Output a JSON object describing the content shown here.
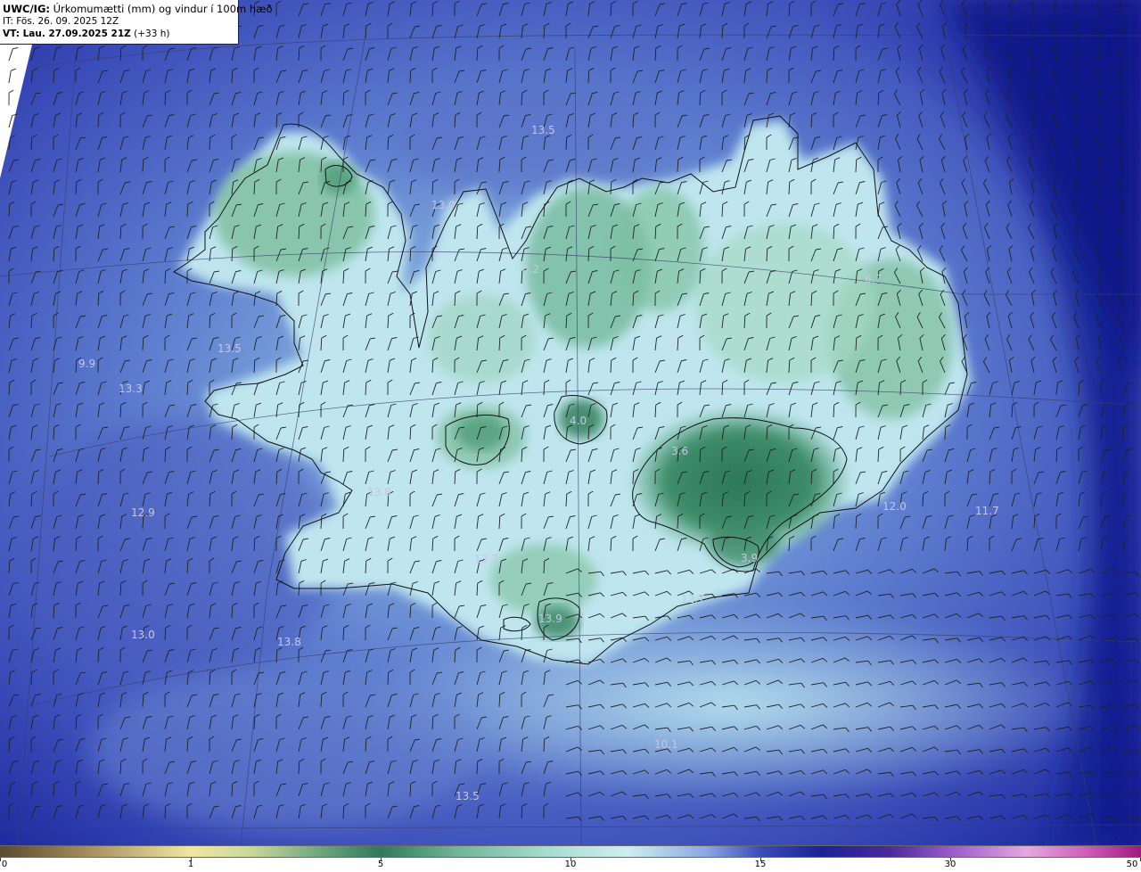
{
  "header": {
    "model": "UWC/IG:",
    "product": " Úrkomumætti (mm) og vindur í 100m hæð",
    "init_label": "IT: Fös. 26. 09. 2025 12Z",
    "valid_prefix": "VT: Lau. 27.09.2025 21Z",
    "valid_suffix": " (+33 h)"
  },
  "colors": {
    "ocean_deep": "#101a8c",
    "ocean_mid": "#3a4cb8",
    "ocean_light": "#6f86d4",
    "pale": "#bfe6ef",
    "cyan": "#8fd6dc",
    "green_light": "#8cc6a8",
    "green": "#4a9a78",
    "green_dark": "#2e7a5a",
    "coast": "#111111"
  },
  "map_labels": [
    {
      "text": "13.5"
    },
    {
      "text": "13.0"
    },
    {
      "text": "4.2"
    },
    {
      "text": "6.7"
    },
    {
      "text": "13.5"
    },
    {
      "text": "9.9"
    },
    {
      "text": "13.3"
    },
    {
      "text": "4.0"
    },
    {
      "text": "3.6"
    },
    {
      "text": "12.0"
    },
    {
      "text": "11.7"
    },
    {
      "text": "13.8"
    },
    {
      "text": "12.9"
    },
    {
      "text": "13.7"
    },
    {
      "text": "13.9"
    },
    {
      "text": "12.7"
    },
    {
      "text": "3.9"
    },
    {
      "text": "13.0"
    },
    {
      "text": "13.8"
    },
    {
      "text": "10.1"
    },
    {
      "text": "13.5"
    }
  ],
  "colorbar": {
    "ticks": [
      {
        "label": "0",
        "value": 0
      },
      {
        "label": "1",
        "value": 1
      },
      {
        "label": "5",
        "value": 5
      },
      {
        "label": "10",
        "value": 10
      },
      {
        "label": "15",
        "value": 15
      },
      {
        "label": "30",
        "value": 30
      },
      {
        "label": "50",
        "value": 50
      }
    ]
  }
}
